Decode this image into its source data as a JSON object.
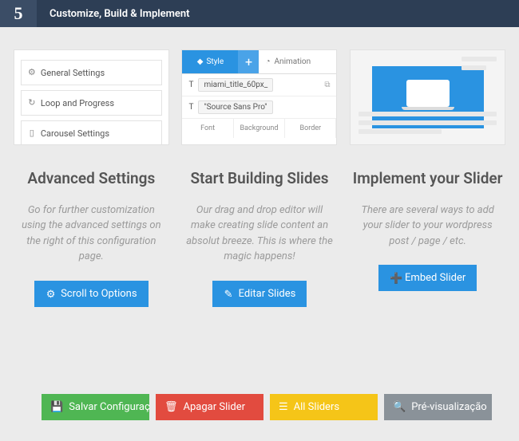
{
  "header": {
    "step": "5",
    "title": "Customize, Build & Implement"
  },
  "thumb1": {
    "row1": "General Settings",
    "row2": "Loop and Progress",
    "row3": "Carousel Settings"
  },
  "thumb2": {
    "tab_style": "Style",
    "tab_anim": "Animation",
    "row1": "miami_title_60px_",
    "row2": "\"Source Sans Pro\"",
    "b1": "Font",
    "b2": "Background",
    "b3": "Border"
  },
  "cards": {
    "advanced": {
      "title": "Advanced Settings",
      "desc": "Go for further customization using the advanced settings on the right of this configuration page.",
      "btn": "Scroll to Options"
    },
    "build": {
      "title": "Start Building Slides",
      "desc": "Our drag and drop editor will make creating slide content an absolut breeze. This is where the magic happens!",
      "btn": "Editar Slides"
    },
    "implement": {
      "title": "Implement your Slider",
      "desc": "There are several ways to add your slider to your wordpress post / page / etc.",
      "btn": "Embed Slider"
    }
  },
  "footer": {
    "save": "Salvar Configurações",
    "delete": "Apagar Slider",
    "all": "All Sliders",
    "preview": "Pré-visualização"
  }
}
